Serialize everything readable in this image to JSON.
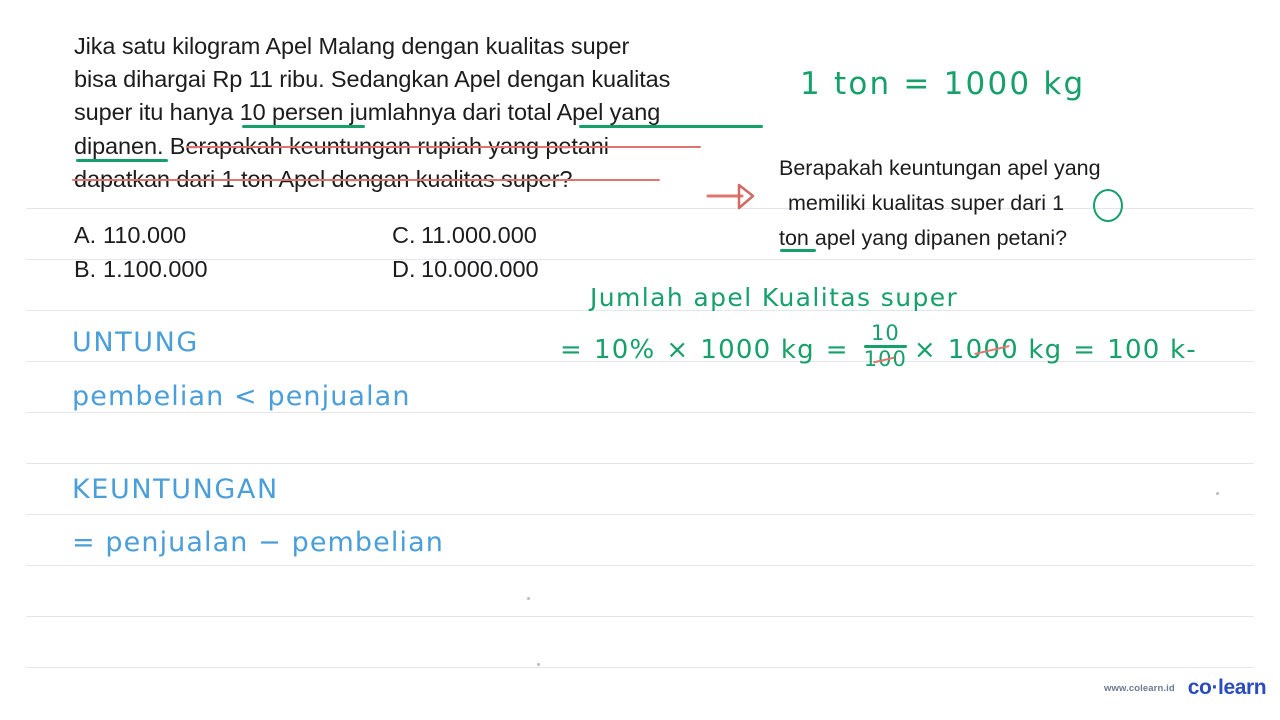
{
  "question_left": {
    "lines": [
      "Jika satu kilogram Apel Malang dengan kualitas super",
      "bisa dihargai Rp 11 ribu. Sedangkan Apel dengan kualitas",
      "super itu hanya 10 persen jumlahnya dari total Apel yang",
      "dipanen. Berapakah keuntungan rupiah yang petani",
      "dapatkan dari 1 ton Apel dengan kualitas super?"
    ]
  },
  "options": [
    {
      "letter": "A.",
      "value": "110.000"
    },
    {
      "letter": "B.",
      "value": "1.100.000"
    },
    {
      "letter": "C.",
      "value": "11.000.000"
    },
    {
      "letter": "D.",
      "value": "10.000.000"
    }
  ],
  "question_right": {
    "lines": [
      "Berapakah keuntungan apel yang",
      " memiliki kualitas super dari",
      "ton apel yang dipanen petani?"
    ],
    "circled_number": "1"
  },
  "annotations": {
    "ton_conversion": "1 ton = 1000 kg",
    "jumlah_label": "Jumlah  apel  Kualitas  super",
    "calc": {
      "eq1": "=",
      "percent_term": "10%",
      "times1": "×",
      "mass1": "1000 kg",
      "eq2": "=",
      "fraction_numerator": "10",
      "fraction_denominator": "100",
      "times2": "×",
      "mass2": "1000 kg",
      "eq3": "=",
      "result": "100 k-"
    },
    "untung_heading": "UNTUNG",
    "untung_rule": "pembelian  <  penjualan",
    "keuntungan_heading": "KEUNTUNGAN",
    "keuntungan_rule": "= penjualan  −  pembelian"
  },
  "colors": {
    "green_marker": "#16a06a",
    "blue_marker": "#4a9ed9",
    "red_marker": "#e0756f",
    "rule_line": "#e3e6ea",
    "brand_blue": "#2b4bc0"
  },
  "branding": {
    "url": "www.colearn.id",
    "logo_left": "co",
    "logo_dot": "·",
    "logo_right": "learn"
  }
}
